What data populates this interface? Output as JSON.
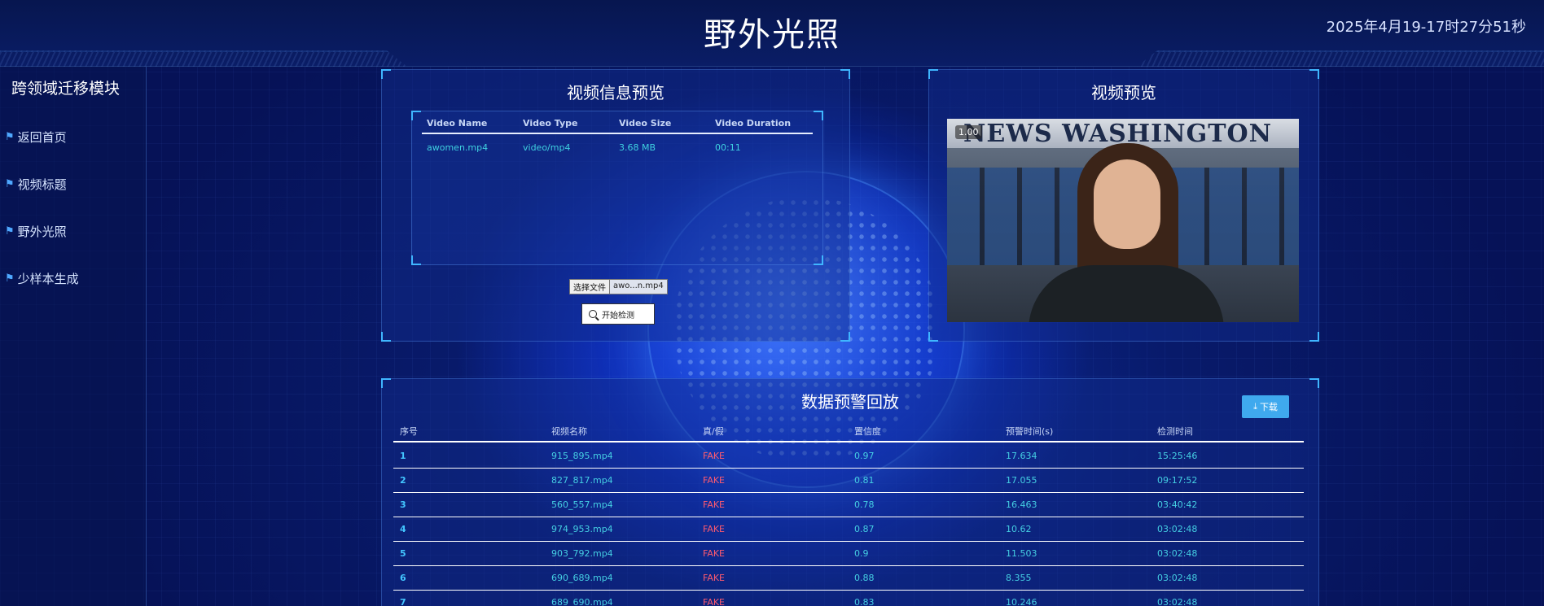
{
  "header": {
    "title": "野外光照",
    "datetime": "2025年4月19-17时27分51秒"
  },
  "sidebar": {
    "title": "跨领域迁移模块",
    "items": [
      {
        "label": "返回首页",
        "icon": "flag-icon"
      },
      {
        "label": "视频标题",
        "icon": "flag-icon"
      },
      {
        "label": "野外光照",
        "icon": "flag-icon"
      },
      {
        "label": "少样本生成",
        "icon": "flag-icon"
      }
    ]
  },
  "video_info": {
    "title": "视频信息预览",
    "columns": [
      "Video Name",
      "Video Type",
      "Video Size",
      "Video Duration"
    ],
    "row": {
      "name": "awomen.mp4",
      "type": "video/mp4",
      "size": "3.68 MB",
      "duration": "00:11"
    },
    "file_button_label": "选择文件",
    "file_name": "awo...n.mp4",
    "detect_button_label": "开始检测"
  },
  "video_preview": {
    "title": "视频预览",
    "speed": "1.00",
    "banner_text": "NEWS WASHINGTON"
  },
  "alerts": {
    "title": "数据预警回放",
    "download_label": "下载",
    "columns": [
      "序号",
      "视频名称",
      "真/假",
      "置信度",
      "预警时间(s)",
      "检测时间"
    ],
    "rows": [
      {
        "idx": "1",
        "name": "915_895.mp4",
        "label": "FAKE",
        "conf": "0.97",
        "alert_time": "17.634",
        "detect_time": "15:25:46"
      },
      {
        "idx": "2",
        "name": "827_817.mp4",
        "label": "FAKE",
        "conf": "0.81",
        "alert_time": "17.055",
        "detect_time": "09:17:52"
      },
      {
        "idx": "3",
        "name": "560_557.mp4",
        "label": "FAKE",
        "conf": "0.78",
        "alert_time": "16.463",
        "detect_time": "03:40:42"
      },
      {
        "idx": "4",
        "name": "974_953.mp4",
        "label": "FAKE",
        "conf": "0.87",
        "alert_time": "10.62",
        "detect_time": "03:02:48"
      },
      {
        "idx": "5",
        "name": "903_792.mp4",
        "label": "FAKE",
        "conf": "0.9",
        "alert_time": "11.503",
        "detect_time": "03:02:48"
      },
      {
        "idx": "6",
        "name": "690_689.mp4",
        "label": "FAKE",
        "conf": "0.88",
        "alert_time": "8.355",
        "detect_time": "03:02:48"
      },
      {
        "idx": "7",
        "name": "689_690.mp4",
        "label": "FAKE",
        "conf": "0.83",
        "alert_time": "10.246",
        "detect_time": "03:02:48"
      }
    ]
  },
  "colors": {
    "accent": "#3fa9ee",
    "fake": "#ff5a6e",
    "cell_text": "#45cfe3"
  }
}
